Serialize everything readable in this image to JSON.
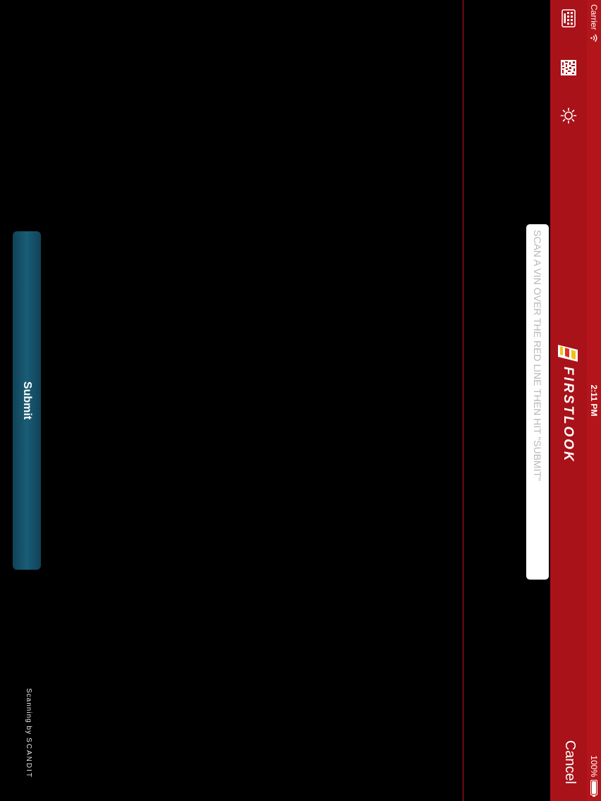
{
  "status_bar": {
    "carrier": "Carrier",
    "time": "2:11 PM",
    "battery": "100%",
    "battery_level": 1.0
  },
  "nav_bar": {
    "icons": [
      "keyboard-icon",
      "barcode-icon",
      "sun-icon"
    ],
    "logo_text": "FIRSTLOOK",
    "cancel_label": "Cancel"
  },
  "scan": {
    "placeholder": "SCAN A VIN OVER THE RED LINE THEN HIT \"SUBMIT\"",
    "value": ""
  },
  "actions": {
    "submit_label": "Submit"
  },
  "footer": {
    "credit_prefix": "Scanning by",
    "credit_brand": "SCANDIT"
  },
  "colors": {
    "nav_red": "#a81218",
    "scan_line": "#c8141b",
    "submit_blue": "#1a5c76",
    "background": "#000000"
  }
}
